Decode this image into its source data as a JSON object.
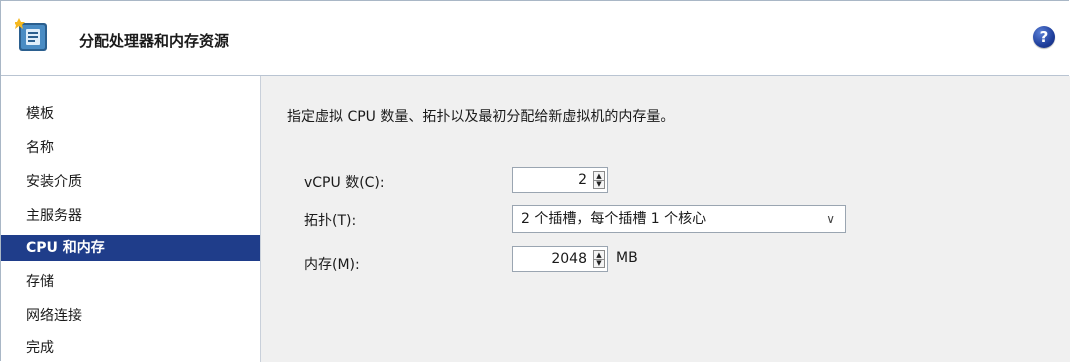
{
  "header": {
    "title": "分配处理器和内存资源",
    "help_label": "?",
    "icon": "wizard-icon",
    "help_icon": "help-icon"
  },
  "sidebar": {
    "items": [
      {
        "label": "模板"
      },
      {
        "label": "名称"
      },
      {
        "label": "安装介质"
      },
      {
        "label": "主服务器"
      },
      {
        "label": "CPU 和内存",
        "active": true
      },
      {
        "label": "存储"
      },
      {
        "label": "网络连接"
      },
      {
        "label": "完成"
      }
    ]
  },
  "main": {
    "description": "指定虚拟 CPU 数量、拓扑以及最初分配给新虚拟机的内存量。",
    "vcpu": {
      "label": "vCPU 数(C):",
      "value": "2"
    },
    "topology": {
      "label": "拓扑(T):",
      "value": "2 个插槽，每个插槽 1 个核心"
    },
    "memory": {
      "label": "内存(M):",
      "value": "2048",
      "unit": "MB"
    }
  },
  "colors": {
    "active_nav_bg": "#1f3d8a",
    "content_bg": "#f0f0f0",
    "help_blue": "#1f3f9c"
  }
}
